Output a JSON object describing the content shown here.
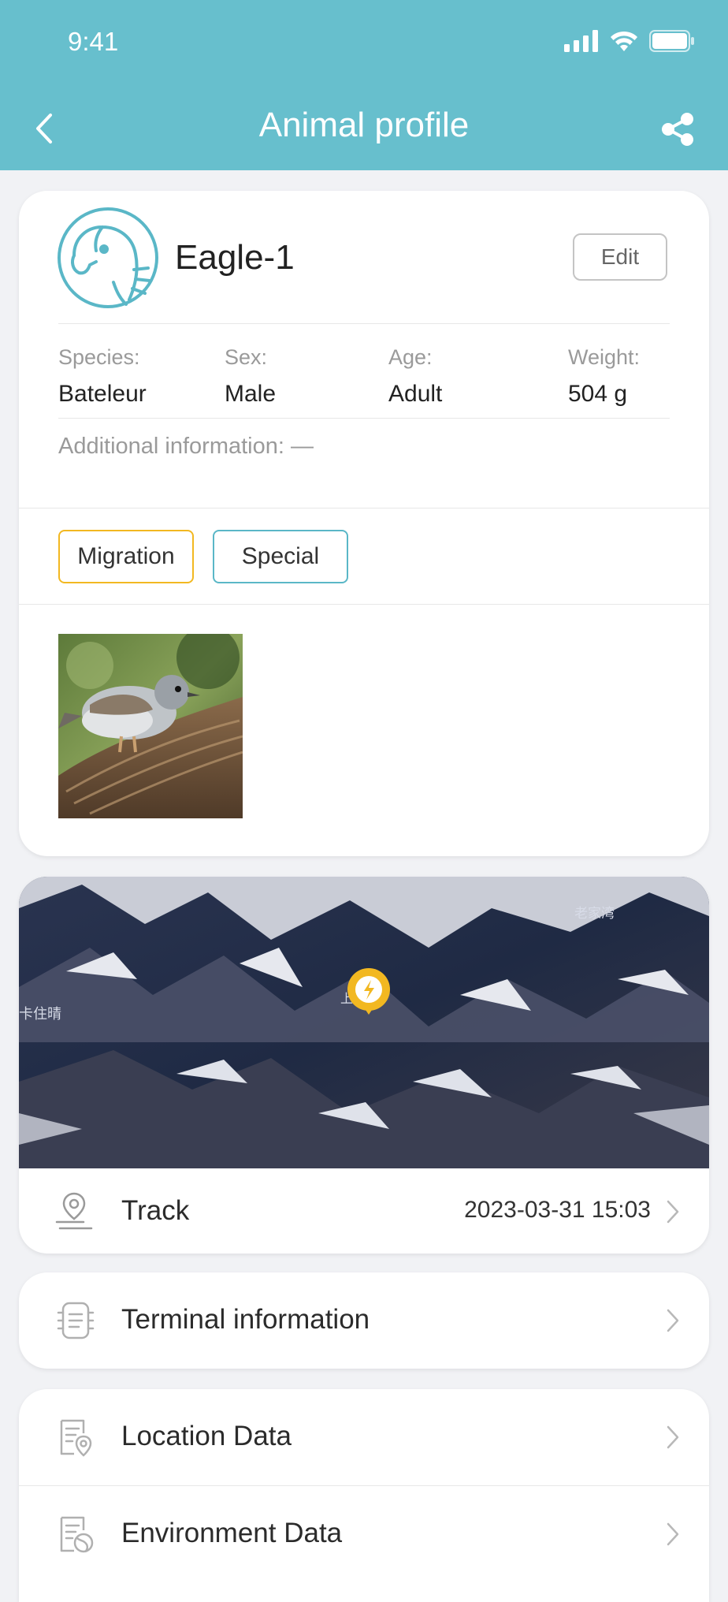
{
  "status_bar": {
    "time": "9:41"
  },
  "nav": {
    "title": "Animal profile",
    "back_icon": "chevron-left-icon",
    "share_icon": "share-icon"
  },
  "profile": {
    "name": "Eagle-1",
    "edit_label": "Edit",
    "fields": [
      {
        "label": "Species:",
        "value": "Bateleur"
      },
      {
        "label": "Sex:",
        "value": "Male"
      },
      {
        "label": "Age:",
        "value": "Adult"
      },
      {
        "label": "Weight:",
        "value": "504 g"
      }
    ],
    "additional_info": "Additional information: —",
    "tags": [
      "Migration",
      "Special"
    ]
  },
  "map": {
    "labels": [
      "卡住晴",
      "上沟湾",
      "老家湾"
    ]
  },
  "track": {
    "label": "Track",
    "time": "2023-03-31 15:03"
  },
  "menu": {
    "terminal": "Terminal information",
    "location": "Location Data",
    "environment": "Environment Data"
  },
  "colors": {
    "header": "#67bfcd",
    "migration_tag": "#f2b821",
    "special_tag": "#5ab7c7",
    "marker": "#f2b821"
  }
}
